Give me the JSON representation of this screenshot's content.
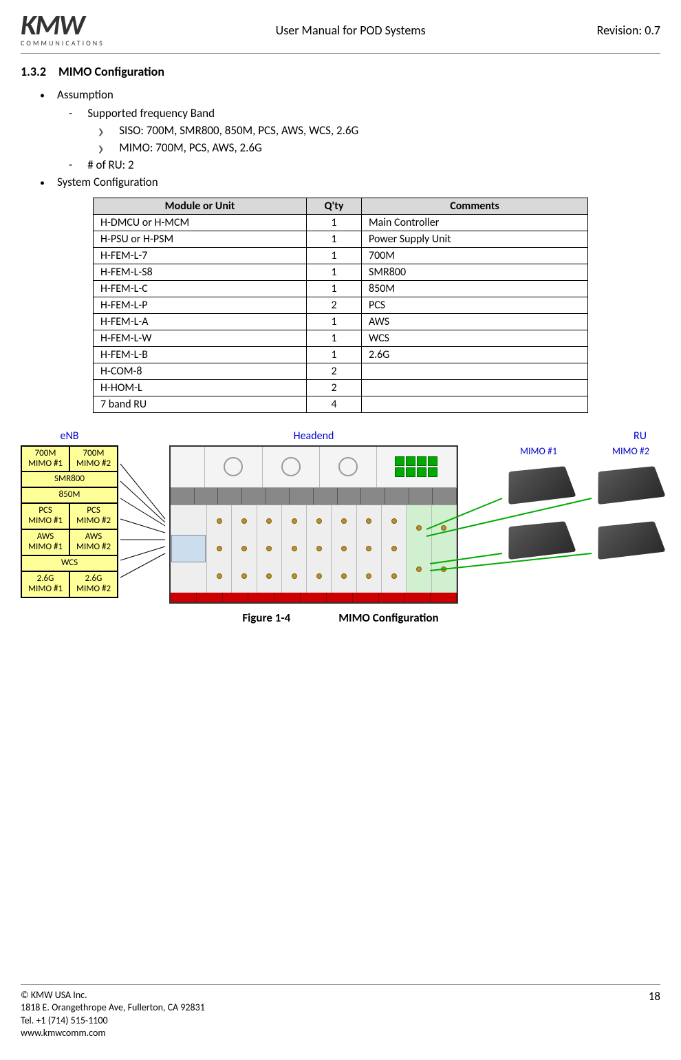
{
  "header": {
    "logo_main": "KMW",
    "logo_sub": "COMMUNICATIONS",
    "title": "User Manual for POD Systems",
    "revision": "Revision: 0.7"
  },
  "section": {
    "number": "1.3.2",
    "title": "MIMO Configuration"
  },
  "bullets": {
    "assumption": "Assumption",
    "freq_band": "Supported frequency Band",
    "siso": "SISO: 700M, SMR800, 850M, PCS, AWS, WCS, 2.6G",
    "mimo": "MIMO: 700M, PCS, AWS, 2.6G",
    "ru_count": "# of RU: 2",
    "system_config": "System Configuration"
  },
  "table": {
    "headers": [
      "Module or Unit",
      "Q'ty",
      "Comments"
    ],
    "rows": [
      {
        "module": "H-DMCU or H-MCM",
        "qty": "1",
        "comment": "Main Controller"
      },
      {
        "module": "H-PSU or H-PSM",
        "qty": "1",
        "comment": "Power Supply Unit"
      },
      {
        "module": "H-FEM-L-7",
        "qty": "1",
        "comment": "700M"
      },
      {
        "module": "H-FEM-L-S8",
        "qty": "1",
        "comment": "SMR800"
      },
      {
        "module": "H-FEM-L-C",
        "qty": "1",
        "comment": "850M"
      },
      {
        "module": "H-FEM-L-P",
        "qty": "2",
        "comment": "PCS"
      },
      {
        "module": "H-FEM-L-A",
        "qty": "1",
        "comment": "AWS"
      },
      {
        "module": "H-FEM-L-W",
        "qty": "1",
        "comment": "WCS"
      },
      {
        "module": "H-FEM-L-B",
        "qty": "1",
        "comment": "2.6G"
      },
      {
        "module": "H-COM-8",
        "qty": "2",
        "comment": ""
      },
      {
        "module": "H-HOM-L",
        "qty": "2",
        "comment": ""
      },
      {
        "module": "7 band RU",
        "qty": "4",
        "comment": ""
      }
    ]
  },
  "figure": {
    "enb_label": "eNB",
    "headend_label": "Headend",
    "ru_label": "RU",
    "mimo1": "MIMO #1",
    "mimo2": "MIMO #2",
    "enb": {
      "r700_1": "700M\nMIMO #1",
      "r700_2": "700M\nMIMO #2",
      "smr800": "SMR800",
      "m850": "850M",
      "pcs_1": "PCS\nMIMO #1",
      "pcs_2": "PCS\nMIMO #2",
      "aws_1": "AWS\nMIMO #1",
      "aws_2": "AWS\nMIMO #2",
      "wcs": "WCS",
      "g26_1": "2.6G\nMIMO #1",
      "g26_2": "2.6G\nMIMO #2"
    },
    "caption_num": "Figure 1-4",
    "caption_text": "MIMO Configuration"
  },
  "footer": {
    "company": "© KMW USA Inc.",
    "address": "1818 E. Orangethrope Ave, Fullerton, CA 92831",
    "tel": "Tel. +1 (714) 515-1100",
    "web": "www.kmwcomm.com",
    "page": "18"
  }
}
